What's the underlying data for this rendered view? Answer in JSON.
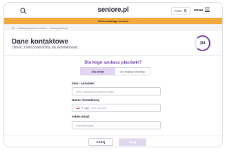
{
  "header": {
    "logo": "seniore.pl",
    "account_label": "Konto",
    "menu_label": "MENU"
  },
  "promo": {
    "text": "Strefa katalogu seniora"
  },
  "breadcrumb": {
    "items": [
      "Katalog placówek seniora",
      "Dodaj placówkę"
    ]
  },
  "form": {
    "title": "Dane kontaktowe",
    "subtitle": "Określ, z kim powinniśmy się skontaktować.",
    "step": "3/4",
    "question": "Dla kogo szukasz placówki?",
    "options": [
      "Dla siebie",
      "Dla mojego bliskiego"
    ],
    "selected_option": "Dla siebie",
    "fields": {
      "name": {
        "label": "Imię i nazwisko",
        "placeholder": "Imię i nazwisko podopiecznego"
      },
      "phone": {
        "label": "Numer kontaktowy",
        "prefix": "+48",
        "placeholder": "000 000 000"
      },
      "email": {
        "label": "Adres email",
        "placeholder": "Email@mailge"
      }
    }
  },
  "footer": {
    "back_label": "Cofnij",
    "next_label": "Dalej"
  },
  "colors": {
    "accent": "#6e3fa8",
    "promo": "#f0a93a",
    "selected_option_bg": "#e3d5f3"
  }
}
